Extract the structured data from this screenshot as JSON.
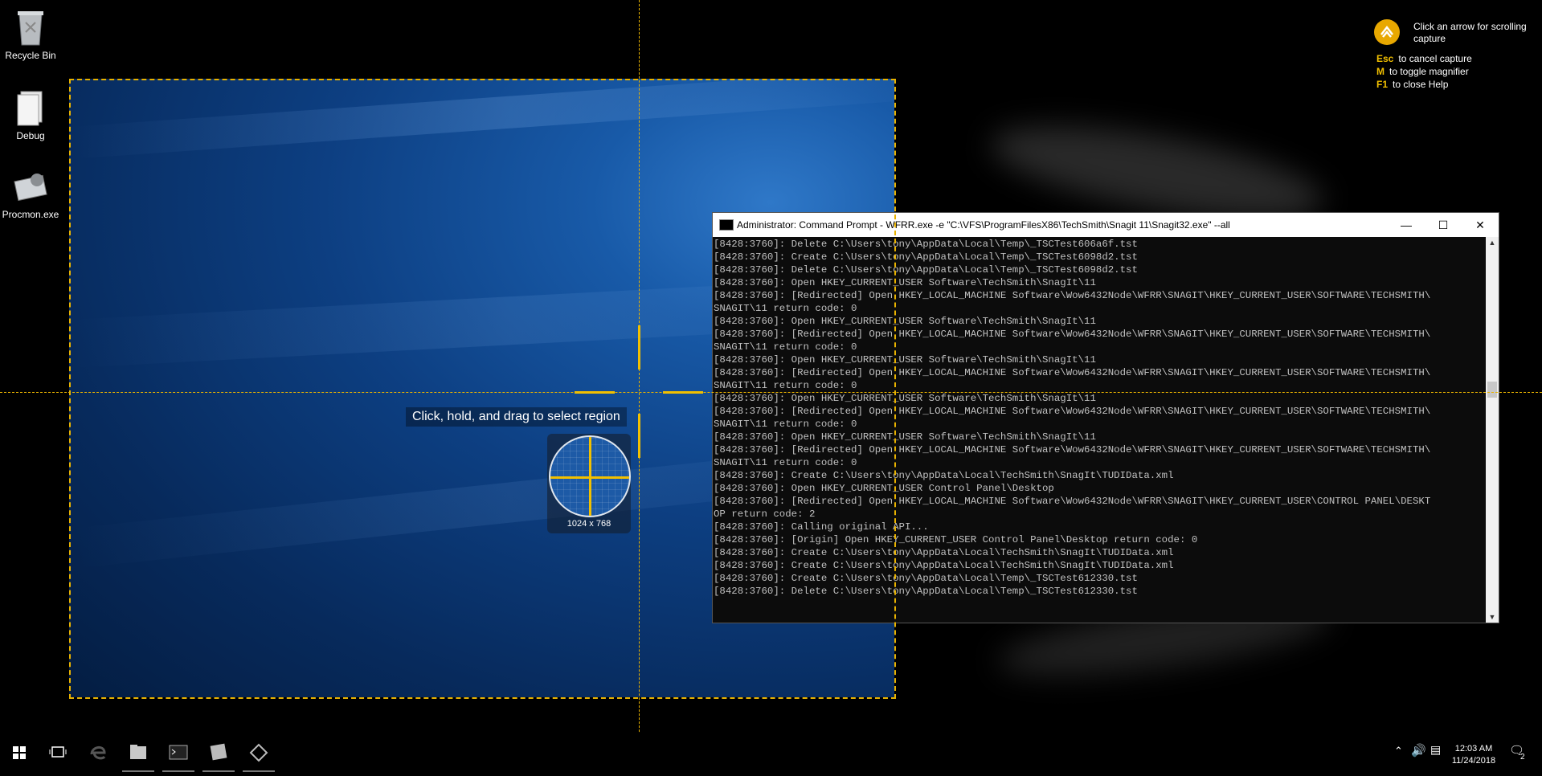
{
  "desktop": {
    "icons": [
      {
        "label": "Recycle Bin",
        "icon": "recycle-bin-icon"
      },
      {
        "label": "Debug",
        "icon": "folder-icon"
      },
      {
        "label": "Procmon.exe",
        "icon": "procmon-icon"
      }
    ]
  },
  "capture": {
    "hint": "Click, hold, and drag to select region",
    "dimensions": "1024 x 768",
    "accent_color": "#e8b200"
  },
  "help": {
    "message": "Click an arrow for scrolling capture",
    "shortcuts": [
      {
        "key": "Esc",
        "text": "to cancel capture"
      },
      {
        "key": "M",
        "text": "to toggle magnifier"
      },
      {
        "key": "F1",
        "text": "to close Help"
      }
    ]
  },
  "cmd": {
    "title": "Administrator: Command Prompt - WFRR.exe  -e \"C:\\VFS\\ProgramFilesX86\\TechSmith\\Snagit 11\\Snagit32.exe\" --all",
    "lines": [
      "[8428:3760]: Delete C:\\Users\\tony\\AppData\\Local\\Temp\\_TSCTest606a6f.tst",
      "[8428:3760]: Create C:\\Users\\tony\\AppData\\Local\\Temp\\_TSCTest6098d2.tst",
      "[8428:3760]: Delete C:\\Users\\tony\\AppData\\Local\\Temp\\_TSCTest6098d2.tst",
      "[8428:3760]: Open HKEY_CURRENT_USER Software\\TechSmith\\SnagIt\\11",
      "[8428:3760]: [Redirected] Open HKEY_LOCAL_MACHINE Software\\Wow6432Node\\WFRR\\SNAGIT\\HKEY_CURRENT_USER\\SOFTWARE\\TECHSMITH\\",
      "SNAGIT\\11 return code: 0",
      "[8428:3760]: Open HKEY_CURRENT_USER Software\\TechSmith\\SnagIt\\11",
      "[8428:3760]: [Redirected] Open HKEY_LOCAL_MACHINE Software\\Wow6432Node\\WFRR\\SNAGIT\\HKEY_CURRENT_USER\\SOFTWARE\\TECHSMITH\\",
      "SNAGIT\\11 return code: 0",
      "[8428:3760]: Open HKEY_CURRENT_USER Software\\TechSmith\\SnagIt\\11",
      "[8428:3760]: [Redirected] Open HKEY_LOCAL_MACHINE Software\\Wow6432Node\\WFRR\\SNAGIT\\HKEY_CURRENT_USER\\SOFTWARE\\TECHSMITH\\",
      "SNAGIT\\11 return code: 0",
      "[8428:3760]: Open HKEY_CURRENT_USER Software\\TechSmith\\SnagIt\\11",
      "[8428:3760]: [Redirected] Open HKEY_LOCAL_MACHINE Software\\Wow6432Node\\WFRR\\SNAGIT\\HKEY_CURRENT_USER\\SOFTWARE\\TECHSMITH\\",
      "SNAGIT\\11 return code: 0",
      "[8428:3760]: Open HKEY_CURRENT_USER Software\\TechSmith\\SnagIt\\11",
      "[8428:3760]: [Redirected] Open HKEY_LOCAL_MACHINE Software\\Wow6432Node\\WFRR\\SNAGIT\\HKEY_CURRENT_USER\\SOFTWARE\\TECHSMITH\\",
      "SNAGIT\\11 return code: 0",
      "[8428:3760]: Create C:\\Users\\tony\\AppData\\Local\\TechSmith\\SnagIt\\TUDIData.xml",
      "[8428:3760]: Open HKEY_CURRENT_USER Control Panel\\Desktop",
      "[8428:3760]: [Redirected] Open HKEY_LOCAL_MACHINE Software\\Wow6432Node\\WFRR\\SNAGIT\\HKEY_CURRENT_USER\\CONTROL PANEL\\DESKT",
      "OP return code: 2",
      "[8428:3760]: Calling original API...",
      "[8428:3760]: [Origin] Open HKEY_CURRENT_USER Control Panel\\Desktop return code: 0",
      "[8428:3760]: Create C:\\Users\\tony\\AppData\\Local\\TechSmith\\SnagIt\\TUDIData.xml",
      "[8428:3760]: Create C:\\Users\\tony\\AppData\\Local\\TechSmith\\SnagIt\\TUDIData.xml",
      "[8428:3760]: Create C:\\Users\\tony\\AppData\\Local\\Temp\\_TSCTest612330.tst",
      "[8428:3760]: Delete C:\\Users\\tony\\AppData\\Local\\Temp\\_TSCTest612330.tst"
    ]
  },
  "taskbar": {
    "items": [
      "start-icon",
      "task-view-icon",
      "edge-icon",
      "file-explorer-icon",
      "command-prompt-icon",
      "snagit-editor-icon",
      "snagit-capture-icon"
    ],
    "clock_time": "12:03 AM",
    "clock_date": "11/24/2018",
    "notification_count": "2"
  }
}
